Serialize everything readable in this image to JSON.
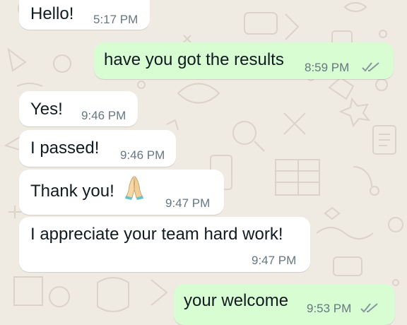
{
  "chat": {
    "messages": [
      {
        "direction": "incoming",
        "text": "Hello!",
        "time": "5:17 PM"
      },
      {
        "direction": "outgoing",
        "text": "have you got the results",
        "time": "8:59 PM",
        "status_icon": "double-check-icon"
      },
      {
        "direction": "incoming",
        "text": "Yes!",
        "time": "9:46 PM"
      },
      {
        "direction": "incoming",
        "text": "I passed!",
        "time": "9:46 PM"
      },
      {
        "direction": "incoming",
        "text": "Thank you!",
        "emoji": "folded-hands-icon",
        "time": "9:47 PM"
      },
      {
        "direction": "incoming",
        "text": "I appreciate your team hard work!",
        "time": "9:47 PM"
      },
      {
        "direction": "outgoing",
        "text": "your welcome",
        "time": "9:53 PM",
        "status_icon": "double-check-icon"
      }
    ]
  },
  "colors": {
    "background": "#efeae2",
    "incoming_bubble": "#ffffff",
    "outgoing_bubble": "#d9fdd3",
    "text": "#111b21",
    "meta": "#667781",
    "tick": "#8696a0"
  }
}
